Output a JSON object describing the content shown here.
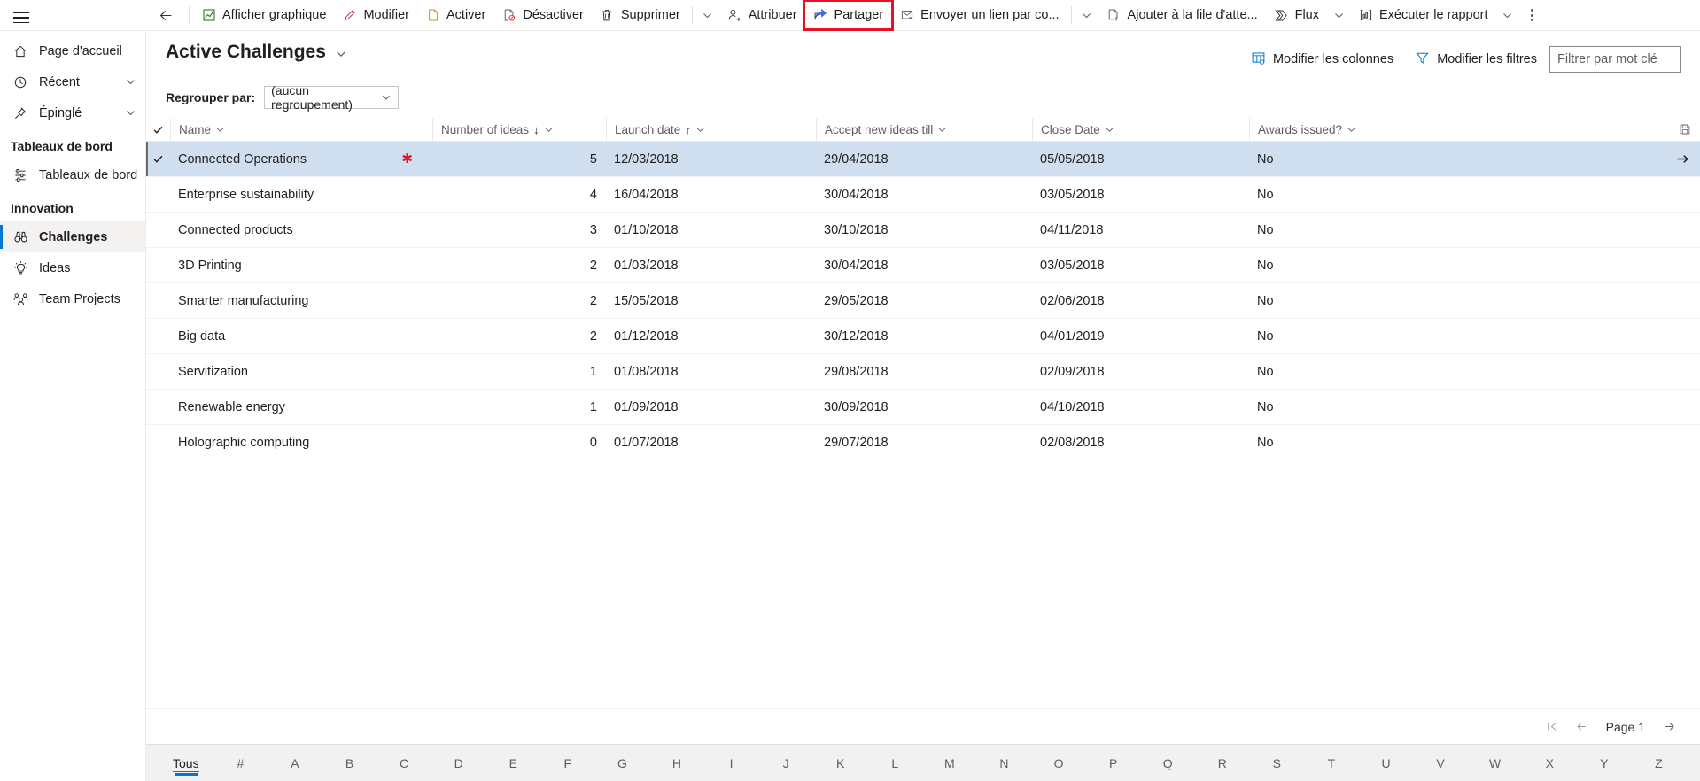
{
  "topbar": {
    "back_icon": "arrow-left-icon",
    "commands": [
      {
        "id": "show-chart",
        "label": "Afficher graphique",
        "icon": "chart-icon"
      },
      {
        "id": "edit",
        "label": "Modifier",
        "icon": "pencil-icon"
      },
      {
        "id": "activate",
        "label": "Activer",
        "icon": "page-icon"
      },
      {
        "id": "deactivate",
        "label": "Désactiver",
        "icon": "page-block-icon"
      },
      {
        "id": "delete",
        "label": "Supprimer",
        "icon": "trash-icon"
      },
      {
        "id": "assign",
        "label": "Attribuer",
        "icon": "person-arrow-icon"
      },
      {
        "id": "share",
        "label": "Partager",
        "icon": "share-icon"
      },
      {
        "id": "email-link",
        "label": "Envoyer un lien par co...",
        "icon": "envelope-link-icon"
      },
      {
        "id": "add-to-queue",
        "label": "Ajouter à la file d'atte...",
        "icon": "page-plus-icon"
      },
      {
        "id": "flow",
        "label": "Flux",
        "icon": "flow-icon"
      },
      {
        "id": "run-report",
        "label": "Exécuter le rapport",
        "icon": "report-icon"
      }
    ],
    "highlighted_command": "share",
    "overflow_label": "more-commands"
  },
  "sidebar": {
    "hamburger_icon": "hamburger-icon",
    "items": [
      {
        "id": "home",
        "label": "Page d'accueil",
        "icon": "home-icon",
        "chevron": false,
        "active": false
      },
      {
        "id": "recent",
        "label": "Récent",
        "icon": "clock-icon",
        "chevron": true,
        "active": false
      },
      {
        "id": "pinned",
        "label": "Épinglé",
        "icon": "pin-icon",
        "chevron": true,
        "active": false
      }
    ],
    "groups": [
      {
        "id": "dashboards",
        "title": "Tableaux de bord",
        "items": [
          {
            "id": "dashboards-item",
            "label": "Tableaux de bord",
            "icon": "dashboard-icon",
            "active": false
          }
        ]
      },
      {
        "id": "innovation",
        "title": "Innovation",
        "items": [
          {
            "id": "challenges",
            "label": "Challenges",
            "icon": "binoculars-icon",
            "active": true
          },
          {
            "id": "ideas",
            "label": "Ideas",
            "icon": "lightbulb-icon",
            "active": false
          },
          {
            "id": "team-projects",
            "label": "Team Projects",
            "icon": "people-icon",
            "active": false
          }
        ]
      }
    ]
  },
  "view": {
    "title": "Active Challenges",
    "title_chevron_icon": "chevron-down-icon",
    "edit_columns_label": "Modifier les colonnes",
    "edit_columns_icon": "columns-icon",
    "edit_filters_label": "Modifier les filtres",
    "edit_filters_icon": "funnel-icon",
    "keyword_placeholder": "Filtrer par mot clé",
    "keyword_value": "",
    "groupby_label": "Regrouper par:",
    "groupby_value": "(aucun regroupement)",
    "groupby_chevron_icon": "chevron-down-icon",
    "save_icon": "save-view-icon"
  },
  "grid": {
    "select_all_icon": "checkmark-icon",
    "columns": [
      {
        "id": "name",
        "label": "Name",
        "sort": "",
        "class": "col-name"
      },
      {
        "id": "ideas",
        "label": "Number of ideas",
        "sort": "desc",
        "class": "col-ideas"
      },
      {
        "id": "launch",
        "label": "Launch date",
        "sort": "asc",
        "class": "col-launch"
      },
      {
        "id": "accept",
        "label": "Accept new ideas till",
        "sort": "",
        "class": "col-accept"
      },
      {
        "id": "close",
        "label": "Close Date",
        "sort": "",
        "class": "col-close"
      },
      {
        "id": "awards",
        "label": "Awards issued?",
        "sort": "",
        "class": "col-awards"
      }
    ],
    "rows": [
      {
        "name": "Connected Operations",
        "ideas": "5",
        "launch": "12/03/2018",
        "accept": "29/04/2018",
        "close": "05/05/2018",
        "awards": "No",
        "selected": true,
        "flagged": true
      },
      {
        "name": "Enterprise sustainability",
        "ideas": "4",
        "launch": "16/04/2018",
        "accept": "30/04/2018",
        "close": "03/05/2018",
        "awards": "No",
        "selected": false,
        "flagged": false
      },
      {
        "name": "Connected products",
        "ideas": "3",
        "launch": "01/10/2018",
        "accept": "30/10/2018",
        "close": "04/11/2018",
        "awards": "No",
        "selected": false,
        "flagged": false
      },
      {
        "name": "3D Printing",
        "ideas": "2",
        "launch": "01/03/2018",
        "accept": "30/04/2018",
        "close": "03/05/2018",
        "awards": "No",
        "selected": false,
        "flagged": false
      },
      {
        "name": "Smarter manufacturing",
        "ideas": "2",
        "launch": "15/05/2018",
        "accept": "29/05/2018",
        "close": "02/06/2018",
        "awards": "No",
        "selected": false,
        "flagged": false
      },
      {
        "name": "Big data",
        "ideas": "2",
        "launch": "01/12/2018",
        "accept": "30/12/2018",
        "close": "04/01/2019",
        "awards": "No",
        "selected": false,
        "flagged": false
      },
      {
        "name": "Servitization",
        "ideas": "1",
        "launch": "01/08/2018",
        "accept": "29/08/2018",
        "close": "02/09/2018",
        "awards": "No",
        "selected": false,
        "flagged": false
      },
      {
        "name": "Renewable energy",
        "ideas": "1",
        "launch": "01/09/2018",
        "accept": "30/09/2018",
        "close": "04/10/2018",
        "awards": "No",
        "selected": false,
        "flagged": false
      },
      {
        "name": "Holographic computing",
        "ideas": "0",
        "launch": "01/07/2018",
        "accept": "29/07/2018",
        "close": "02/08/2018",
        "awards": "No",
        "selected": false,
        "flagged": false
      }
    ],
    "row_open_icon": "arrow-right-icon"
  },
  "pager": {
    "first_icon": "page-first-icon",
    "prev_icon": "page-prev-icon",
    "next_icon": "page-next-icon",
    "label": "Page 1"
  },
  "alpha_bar": {
    "active": "Tous",
    "items": [
      "Tous",
      "#",
      "A",
      "B",
      "C",
      "D",
      "E",
      "F",
      "G",
      "H",
      "I",
      "J",
      "K",
      "L",
      "M",
      "N",
      "O",
      "P",
      "Q",
      "R",
      "S",
      "T",
      "U",
      "V",
      "W",
      "X",
      "Y",
      "Z"
    ]
  },
  "colors": {
    "accent": "#0078d4",
    "selection": "#cfdff0",
    "highlight_outline": "#e81123",
    "required_star": "#e81123"
  }
}
